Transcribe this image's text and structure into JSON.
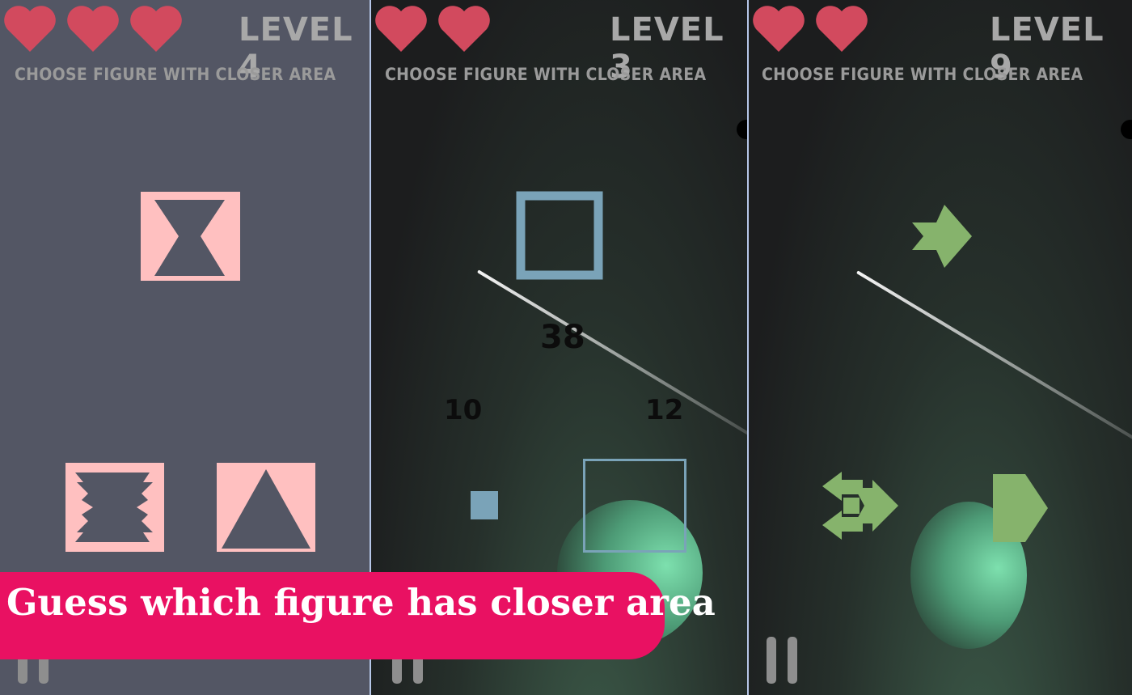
{
  "panels": [
    {
      "level": "LEVEL 4",
      "subtitle": "CHOOSE FIGURE WITH CLOSER AREA",
      "lives": 3,
      "numbers": []
    },
    {
      "level": "LEVEL 3",
      "subtitle": "CHOOSE FIGURE WITH CLOSER AREA",
      "lives": 2,
      "numbers": [
        "38",
        "10",
        "12"
      ]
    },
    {
      "level": "LEVEL 9",
      "subtitle": "CHOOSE FIGURE WITH CLOSER AREA",
      "lives": 2,
      "numbers": []
    }
  ],
  "banner": {
    "text": "Guess which figure has closer area"
  },
  "icons": {
    "heart": "heart-icon",
    "pause": "pause-icon"
  },
  "colors": {
    "heart": "#d24a5e",
    "pink_shape": "#ffc0c0",
    "blue_shape": "#7aa3b8",
    "green_shape": "#86b36c",
    "banner": "#e91162",
    "level_text": "#a8a8a8"
  }
}
